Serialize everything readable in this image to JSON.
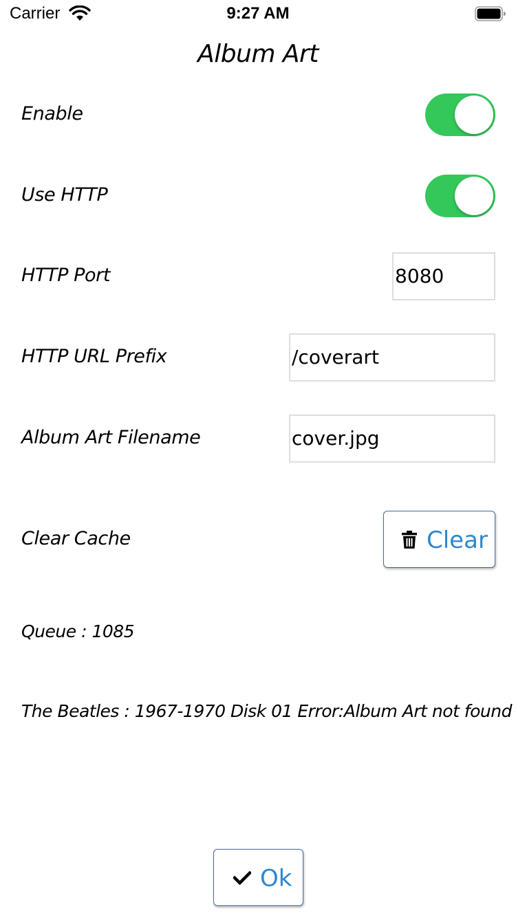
{
  "status_bar": {
    "carrier": "Carrier",
    "time": "9:27 AM",
    "wifi_icon": "wifi-icon",
    "battery_icon": "battery-icon"
  },
  "title": "Album Art",
  "settings": {
    "enable": {
      "label": "Enable",
      "on": true
    },
    "use_http": {
      "label": "Use HTTP",
      "on": true
    },
    "http_port": {
      "label": "HTTP Port",
      "value": "8080"
    },
    "http_url_prefix": {
      "label": "HTTP URL Prefix",
      "value": "/coverart"
    },
    "album_art_filename": {
      "label": "Album Art Filename",
      "value": "cover.jpg"
    },
    "clear_cache": {
      "label": "Clear Cache",
      "button_label": "Clear",
      "button_icon": "trash-icon"
    }
  },
  "queue_text": "Queue : 1085",
  "error_text": "The Beatles : 1967-1970 Disk 01 Error:Album Art not found",
  "ok_button": {
    "label": "Ok",
    "icon": "checkmark-icon"
  },
  "colors": {
    "toggle_on": "#34c759",
    "button_text": "#2d86d0",
    "button_border": "#4a6c96",
    "field_border": "#dddddd"
  }
}
